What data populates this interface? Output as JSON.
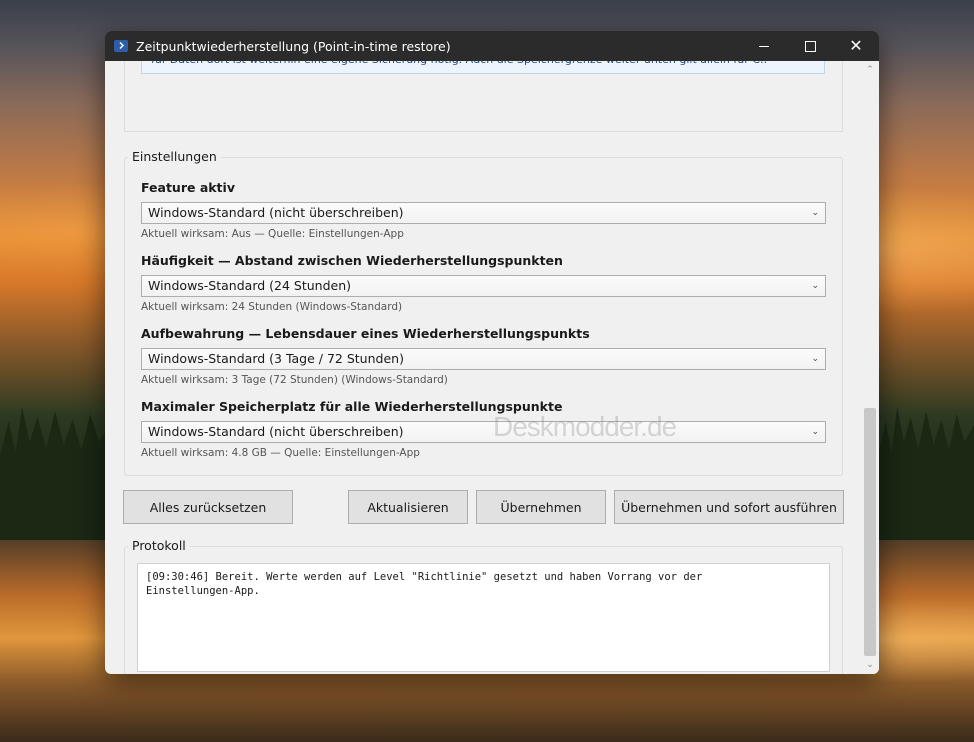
{
  "window": {
    "title": "Zeitpunktwiederherstellung (Point-in-time restore)",
    "minimize": "—",
    "maximize": "☐",
    "close": "✕"
  },
  "info": {
    "text": "für Daten dort ist weiterhin eine eigene Sicherung nötig. Auch die Speichergrenze weiter unten gilt allein für C:."
  },
  "settings": {
    "caption": "Einstellungen",
    "items": [
      {
        "label": "Feature aktiv",
        "value": "Windows-Standard (nicht überschreiben)",
        "note": "Aktuell wirksam: Aus — Quelle: Einstellungen-App"
      },
      {
        "label": "Häufigkeit — Abstand zwischen Wiederherstellungspunkten",
        "value": "Windows-Standard (24 Stunden)",
        "note": "Aktuell wirksam: 24 Stunden (Windows-Standard)"
      },
      {
        "label": "Aufbewahrung — Lebensdauer eines Wiederherstellungspunkts",
        "value": "Windows-Standard (3 Tage / 72 Stunden)",
        "note": "Aktuell wirksam: 3 Tage (72 Stunden) (Windows-Standard)"
      },
      {
        "label": "Maximaler Speicherplatz für alle Wiederherstellungspunkte",
        "value": "Windows-Standard (nicht überschreiben)",
        "note": "Aktuell wirksam: 4.8 GB — Quelle: Einstellungen-App"
      }
    ]
  },
  "buttons": {
    "reset": "Alles zurücksetzen",
    "refresh": "Aktualisieren",
    "apply": "Übernehmen",
    "apply_run": "Übernehmen und sofort ausführen"
  },
  "log": {
    "caption": "Protokoll",
    "text": "[09:30:46] Bereit. Werte werden auf Level \"Richtlinie\" gesetzt und haben Vorrang vor der\nEinstellungen-App."
  },
  "watermark": "Deskmodder.de",
  "icons": {
    "app": "powershell-icon",
    "dropdown": "chevron-down-icon"
  }
}
